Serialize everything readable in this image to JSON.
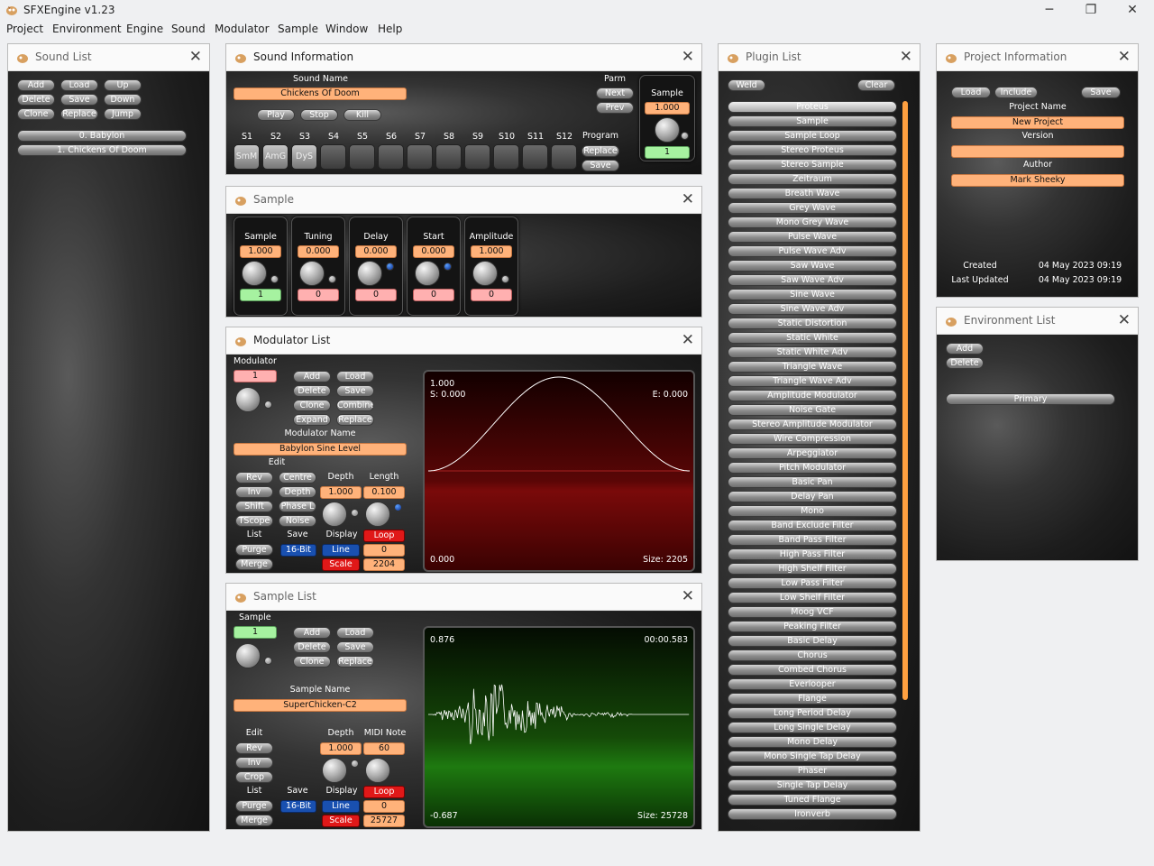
{
  "app": {
    "title": "SFXEngine v1.23",
    "min": "─",
    "max": "❐",
    "close": "✕"
  },
  "menu": [
    "Project",
    "Environment",
    "Engine",
    "Sound",
    "Modulator",
    "Sample",
    "Window",
    "Help"
  ],
  "close_glyph": "✕",
  "sound_list": {
    "title": "Sound List",
    "buttons": [
      "Add",
      "Load",
      "Up",
      "Delete",
      "Save",
      "Down",
      "Clone",
      "Replace",
      "Jump"
    ],
    "items": [
      "0. Babylon",
      "1. Chickens Of Doom"
    ]
  },
  "sound_info": {
    "title": "Sound Information",
    "sound_name_label": "Sound Name",
    "sound_name": "Chickens Of Doom",
    "play": "Play",
    "stop": "Stop",
    "kill": "Kill",
    "parm": "Parm",
    "next": "Next",
    "prev": "Prev",
    "program": "Program",
    "replace": "Replace",
    "save": "Save",
    "sample_label": "Sample",
    "sample_value": "1.000",
    "sample_index": "1",
    "slots": [
      "S1",
      "S2",
      "S3",
      "S4",
      "S5",
      "S6",
      "S7",
      "S8",
      "S9",
      "S10",
      "S11",
      "S12"
    ],
    "slot_values": [
      "SmM",
      "AmG",
      "DyS",
      "",
      "",
      "",
      "",
      "",
      "",
      "",
      "",
      ""
    ]
  },
  "sample": {
    "title": "Sample",
    "cells": [
      {
        "label": "Sample",
        "value": "1.000",
        "index": "1"
      },
      {
        "label": "Tuning",
        "value": "0.000",
        "index": "0"
      },
      {
        "label": "Delay",
        "value": "0.000",
        "index": "0"
      },
      {
        "label": "Start",
        "value": "0.000",
        "index": "0"
      },
      {
        "label": "Amplitude",
        "value": "1.000",
        "index": "0"
      }
    ]
  },
  "modulator": {
    "title": "Modulator List",
    "mod_label": "Modulator",
    "mod_index": "1",
    "add": "Add",
    "load": "Load",
    "delete": "Delete",
    "save": "Save",
    "clone": "Clone",
    "combine": "Combine",
    "expand": "Expand",
    "replace": "Replace",
    "name_label": "Modulator Name",
    "name": "Babylon Sine Level",
    "edit": "Edit",
    "rev": "Rev",
    "centre": "Centre",
    "inv": "Inv",
    "depth_btn": "Depth",
    "shift": "Shift",
    "phasel": "Phase L",
    "tscope": "TScope",
    "noise": "Noise",
    "depth_label": "Depth",
    "depth": "1.000",
    "length_label": "Length",
    "length": "0.100",
    "list": "List",
    "save_label": "Save",
    "display": "Display",
    "loop": "Loop",
    "purge": "Purge",
    "bit16": "16-Bit",
    "line": "Line",
    "line_val": "0",
    "merge": "Merge",
    "scale": "Scale",
    "scale_val": "2204",
    "scope_max": "1.000",
    "scope_s": "S: 0.000",
    "scope_e": "E: 0.000",
    "scope_min": "0.000",
    "scope_size": "Size: 2205"
  },
  "sample_list": {
    "title": "Sample List",
    "sample_label": "Sample",
    "sample_index": "1",
    "add": "Add",
    "load": "Load",
    "delete": "Delete",
    "save": "Save",
    "clone": "Clone",
    "replace": "Replace",
    "name_label": "Sample Name",
    "name": "SuperChicken-C2",
    "edit": "Edit",
    "rev": "Rev",
    "inv": "Inv",
    "crop": "Crop",
    "depth_label": "Depth",
    "depth": "1.000",
    "midi_label": "MIDI Note",
    "midi": "60",
    "list": "List",
    "save_label": "Save",
    "display": "Display",
    "loop": "Loop",
    "purge": "Purge",
    "bit16": "16-Bit",
    "line": "Line",
    "line_val": "0",
    "merge": "Merge",
    "scale": "Scale",
    "scale_val": "25727",
    "scope_max": "0.876",
    "scope_time": "00:00.583",
    "scope_min": "-0.687",
    "scope_size": "Size: 25728"
  },
  "plugin_list": {
    "title": "Plugin List",
    "weld": "Weld",
    "clear": "Clear",
    "items": [
      "Proteus",
      "Sample",
      "Sample Loop",
      "Stereo Proteus",
      "Stereo Sample",
      "Zeitraum",
      "Breath Wave",
      "Grey Wave",
      "Mono Grey Wave",
      "Pulse Wave",
      "Pulse Wave Adv",
      "Saw Wave",
      "Saw Wave Adv",
      "Sine Wave",
      "Sine Wave Adv",
      "Static Distortion",
      "Static White",
      "Static White Adv",
      "Triangle Wave",
      "Triangle Wave Adv",
      "Amplitude Modulator",
      "Noise Gate",
      "Stereo Amplitude Modulator",
      "Wire Compression",
      "Arpeggiator",
      "Pitch Modulator",
      "Basic Pan",
      "Delay Pan",
      "Mono",
      "Band Exclude Filter",
      "Band Pass Filter",
      "High Pass Filter",
      "High Shelf Filter",
      "Low Pass Filter",
      "Low Shelf Filter",
      "Moog VCF",
      "Peaking Filter",
      "Basic Delay",
      "Chorus",
      "Combed Chorus",
      "Everlooper",
      "Flange",
      "Long Period Delay",
      "Long Single Delay",
      "Mono Delay",
      "Mono Single Tap Delay",
      "Phaser",
      "Single Tap Delay",
      "Tuned Flange",
      "Ironverb"
    ]
  },
  "project": {
    "title": "Project Information",
    "load": "Load",
    "include": "Include",
    "save": "Save",
    "name_label": "Project Name",
    "name": "New Project",
    "version_label": "Version",
    "version": "",
    "author_label": "Author",
    "author": "Mark Sheeky",
    "created_label": "Created",
    "created": "04 May 2023 09:19",
    "updated_label": "Last Updated",
    "updated": "04 May 2023 09:19"
  },
  "environment": {
    "title": "Environment List",
    "add": "Add",
    "delete": "Delete",
    "items": [
      "Primary"
    ]
  },
  "colors": {
    "field": "#ffb27a",
    "green": "#a6f2a0",
    "pink": "#ffb0b0",
    "red": "#e01818",
    "blue": "#1950b0",
    "scope_red": "#7a0a0a",
    "scope_green": "#1e7a10",
    "accent": "#ffa040"
  }
}
